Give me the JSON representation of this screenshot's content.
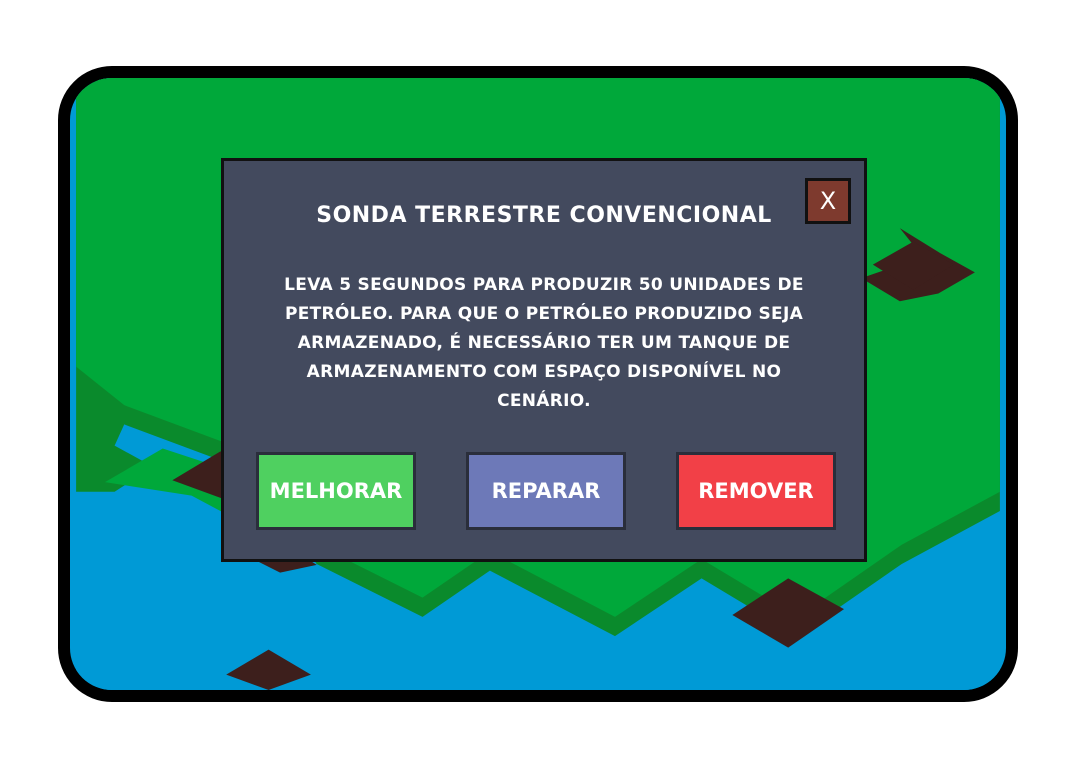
{
  "modal": {
    "title": "SONDA TERRESTRE CONVENCIONAL",
    "description": "LEVA 5 SEGUNDOS PARA PRODUZIR 50 UNIDADES DE PETRÓLEO. PARA QUE O PETRÓLEO PRODUZIDO SEJA ARMAZENADO, É NECESSÁRIO TER UM TANQUE DE ARMAZENAMENTO COM ESPAÇO DISPONÍVEL NO CENÁRIO.",
    "close_label": "X",
    "buttons": {
      "upgrade": "MELHORAR",
      "repair": "REPARAR",
      "remove": "REMOVER"
    }
  },
  "colors": {
    "grass": "#00a83a",
    "water": "#009ad6",
    "soil": "#3d1f1c",
    "modal_bg": "#434a5e",
    "upgrade": "#4fd060",
    "repair": "#6d79b8",
    "remove": "#f24047",
    "close": "#7e3a2e"
  }
}
